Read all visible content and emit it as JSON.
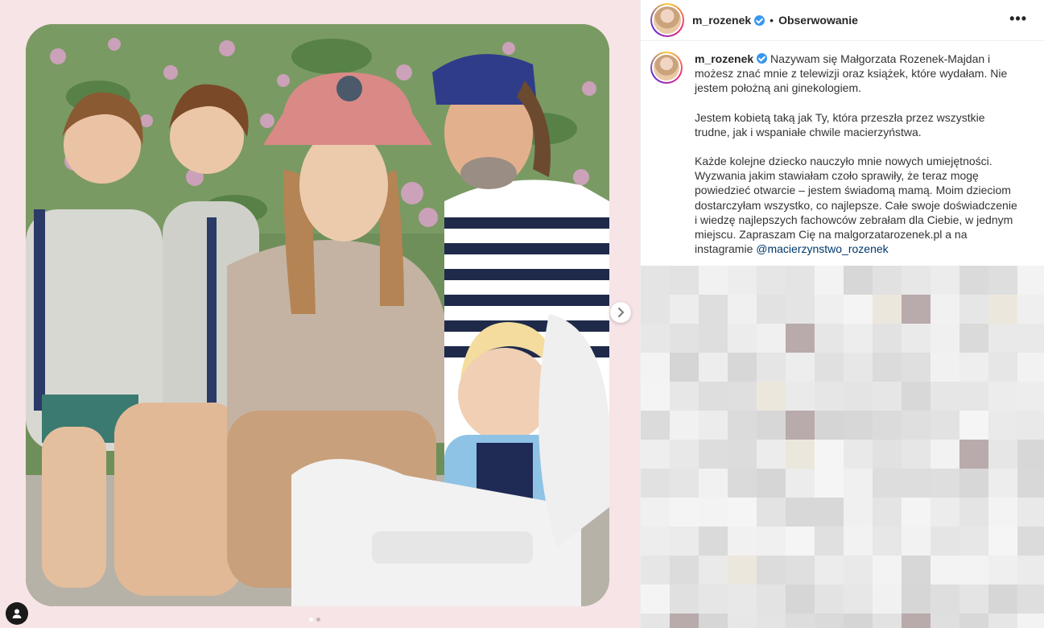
{
  "post": {
    "username": "m_rozenek",
    "separator": "•",
    "follow_label": "Obserwowanie",
    "more_label": "•••",
    "verified": true
  },
  "caption": {
    "username": "m_rozenek",
    "para1": "Nazywam się Małgorzata Rozenek-Majdan i możesz znać mnie z telewizji oraz książek, które wydałam. Nie jestem położną ani ginekologiem.",
    "para2": "Jestem kobietą taką jak Ty, która przeszła przez wszystkie trudne, jak i wspaniałe chwile macierzyństwa.",
    "para3_pre": "Każde kolejne dziecko nauczyło mnie nowych umiejętności. Wyzwania jakim stawiałam czoło sprawiły, że teraz mogę powiedzieć otwarcie – jestem świadomą mamą. Moim dzieciom dostarczyłam wszystko, co najlepsze. Całe swoje doświadczenie i wiedzę najlepszych fachowców zebrałam dla Ciebie, w jednym miejscu. Zapraszam Cię na malgorzatarozenek.pl a na instagramie ",
    "mention": "@macierzynstwo_rozenek"
  },
  "carousel": {
    "slide_count": 2,
    "active_index": 0
  },
  "icons": {
    "next": "chevron-right-icon",
    "tag": "user-tag-icon",
    "verified": "verified-badge-icon",
    "more": "more-options-icon"
  },
  "colors": {
    "media_background": "#f7e4e6",
    "verified": "#3897f0",
    "mention": "#00376b"
  }
}
